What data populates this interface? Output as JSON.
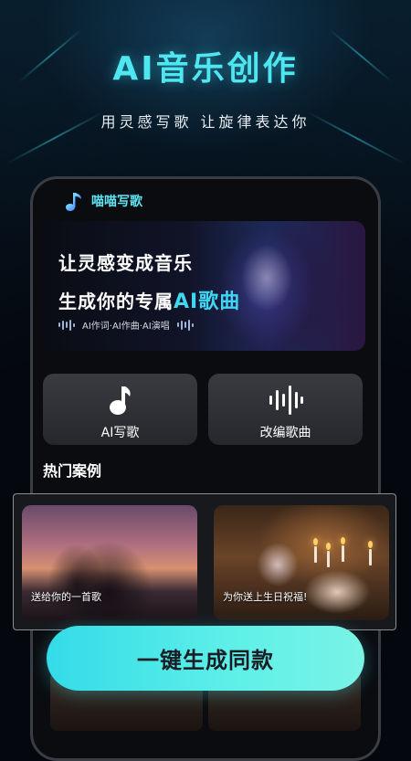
{
  "hero": {
    "title": "AI音乐创作",
    "subtitle": "用灵感写歌 让旋律表达你"
  },
  "app": {
    "name": "喵喵写歌",
    "logo_icon": "music-note-icon"
  },
  "banner": {
    "line1": "让灵感变成音乐",
    "line2_prefix": "生成你的专属",
    "line2_highlight": "AI歌曲",
    "tagline": "AI作词·AI作曲·AI演唱"
  },
  "features": [
    {
      "label": "AI写歌",
      "icon": "music-note-icon"
    },
    {
      "label": "改编歌曲",
      "icon": "sound-wave-icon"
    }
  ],
  "section": {
    "hot_cases_title": "热门案例"
  },
  "cases": [
    {
      "caption": "送给你的一首歌"
    },
    {
      "caption": "为你送上生日祝福!"
    }
  ],
  "cta": {
    "label": "一键生成同款"
  },
  "colors": {
    "accent": "#4ee6f0",
    "cta_start": "#33dbe8",
    "cta_end": "#7af3e6",
    "background": "#04070d"
  }
}
